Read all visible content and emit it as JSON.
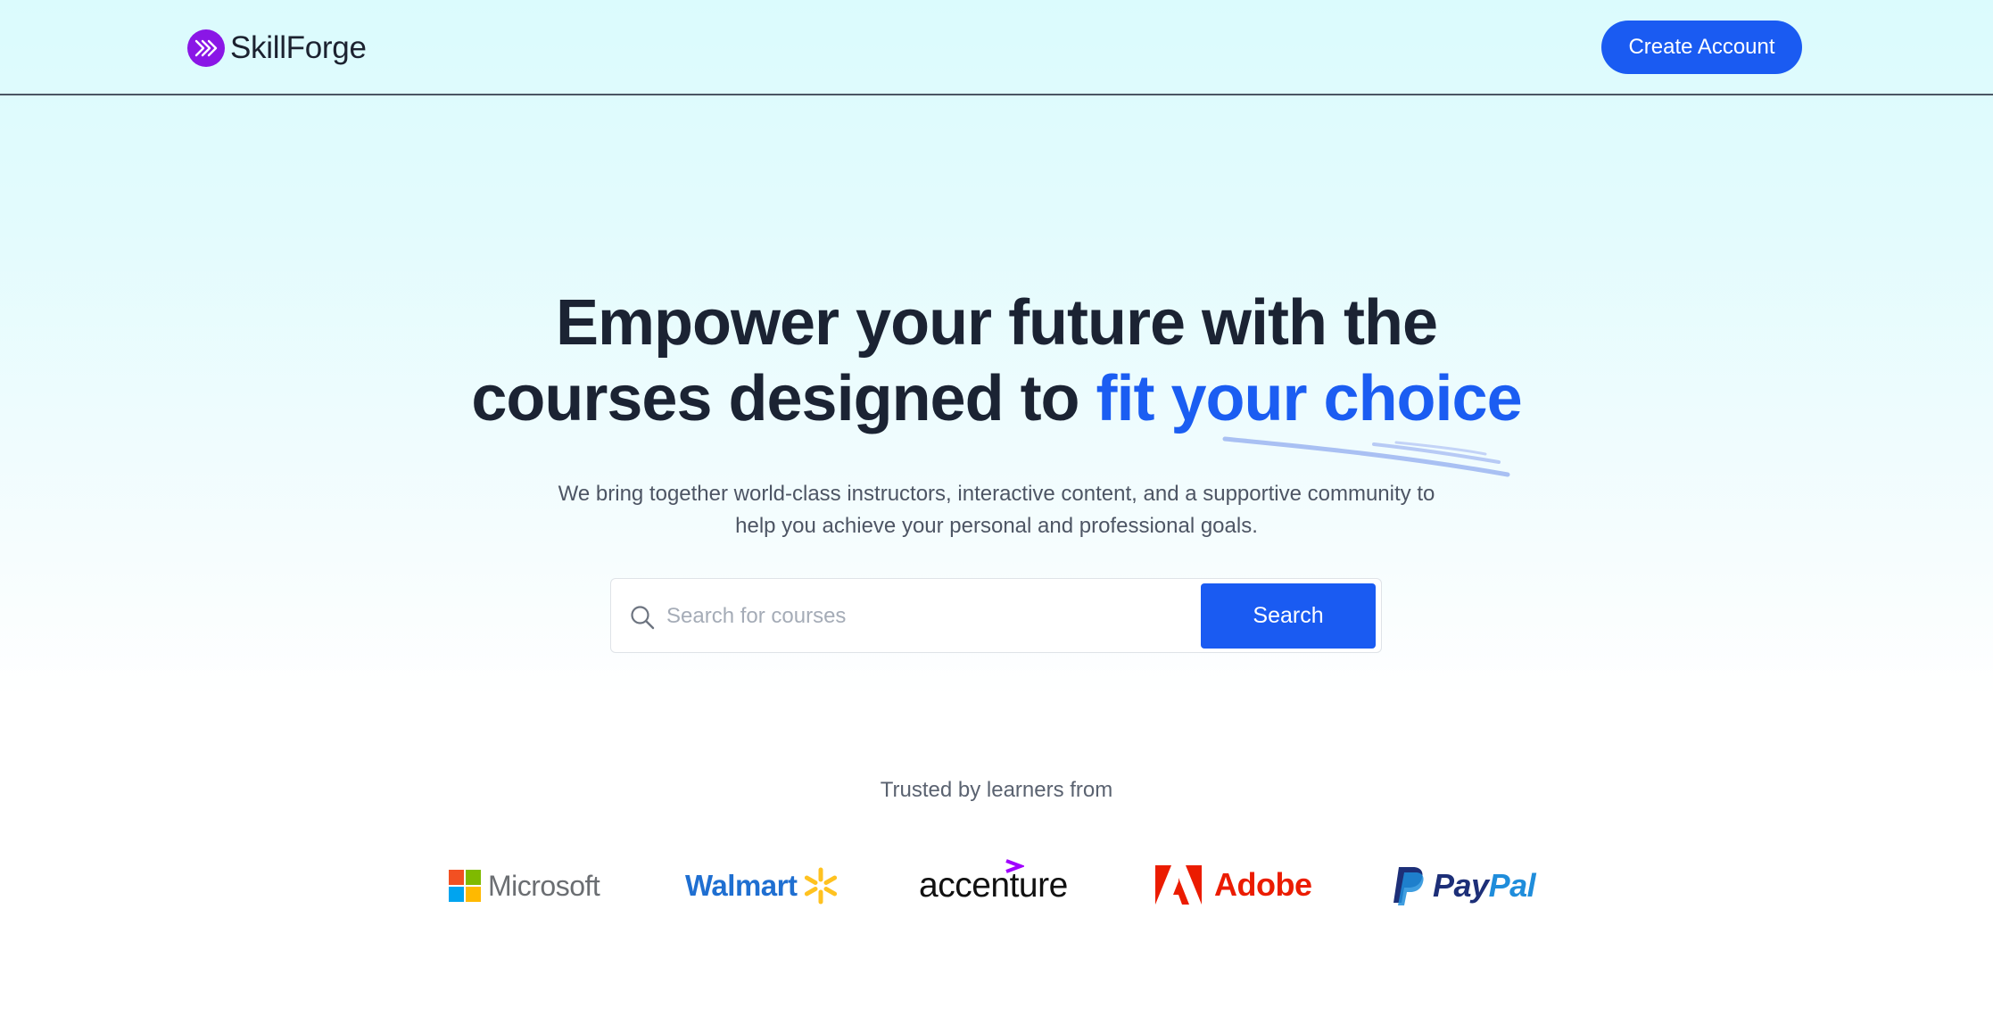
{
  "header": {
    "brand_name": "SkillForge",
    "create_account_label": "Create Account"
  },
  "hero": {
    "title_line1": "Empower your future with the",
    "title_line2_prefix": "courses designed to",
    "title_line2_accent": "fit your choice",
    "subtitle_line1": "We bring together world-class instructors, interactive content, and a supportive community to",
    "subtitle_line2": "help you achieve your personal and professional goals."
  },
  "search": {
    "placeholder": "Search for courses",
    "value": "",
    "button_label": "Search",
    "icon": "search-icon"
  },
  "trusted": {
    "label": "Trusted by learners from",
    "logos": [
      {
        "name": "Microsoft"
      },
      {
        "name": "Walmart"
      },
      {
        "name": "accenture"
      },
      {
        "name": "Adobe"
      },
      {
        "name": "PayPal"
      }
    ]
  },
  "colors": {
    "accent": "#1a5bf2",
    "brand_purple": "#8a16e6",
    "heading": "#1b2333",
    "body_text": "#4d5564",
    "header_background": "#dbfbfd"
  }
}
